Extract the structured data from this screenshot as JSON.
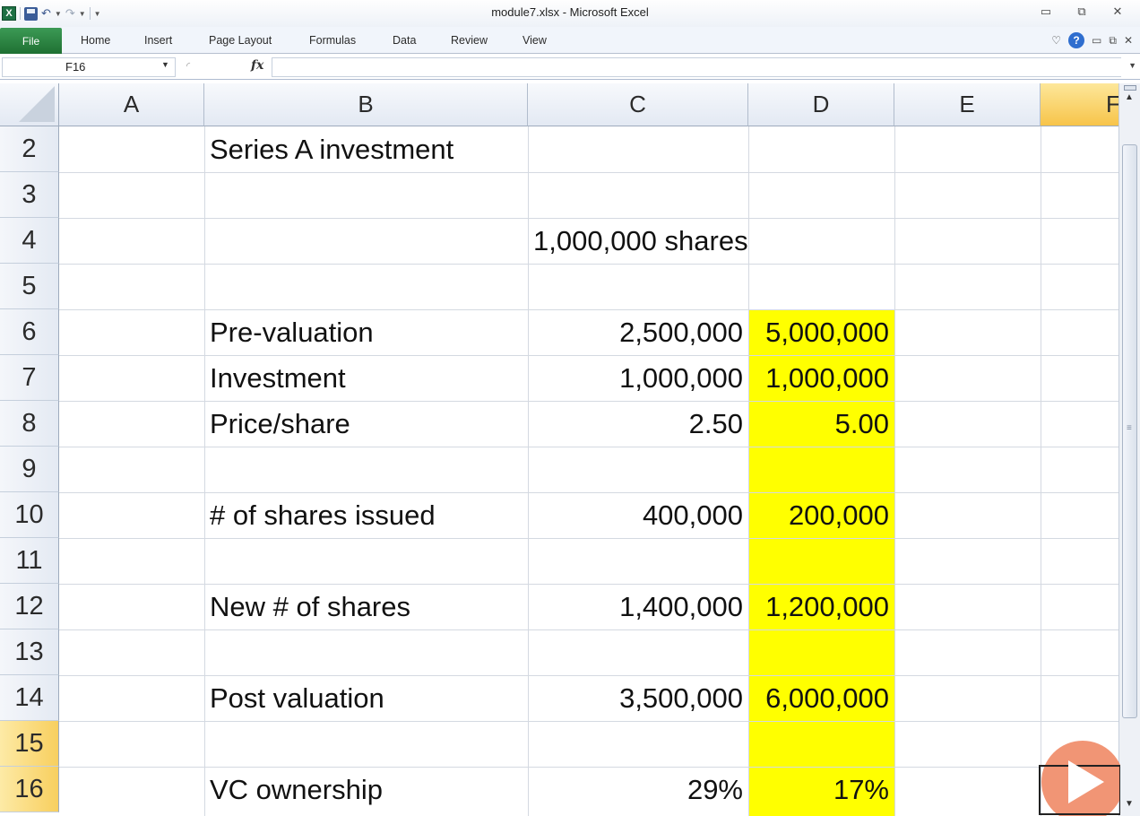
{
  "window": {
    "title": "module7.xlsx - Microsoft Excel",
    "app_icon": "excel-icon",
    "quick_access": [
      "save-icon",
      "undo-icon",
      "redo-icon",
      "customize-icon"
    ],
    "controls": [
      "minimize-icon",
      "restore-icon",
      "close-icon"
    ]
  },
  "ribbon": {
    "file_label": "File",
    "tabs": [
      "Home",
      "Insert",
      "Page Layout",
      "Formulas",
      "Data",
      "Review",
      "View"
    ],
    "right_icons": [
      "minimize-ribbon-icon",
      "help-icon",
      "minimize-icon",
      "restore-icon",
      "close-icon"
    ]
  },
  "formula_bar": {
    "name_box": "F16",
    "fx_label": "fx",
    "formula": ""
  },
  "sheet": {
    "selected_cell": "F16",
    "columns": [
      "A",
      "B",
      "C",
      "D",
      "E",
      "F"
    ],
    "rows": [
      "2",
      "3",
      "4",
      "5",
      "6",
      "7",
      "8",
      "9",
      "10",
      "11",
      "12",
      "13",
      "14",
      "15",
      "16"
    ],
    "cells": {
      "B2": "Series A investment",
      "C4": "1,000,000 shares",
      "B6": "Pre-valuation",
      "C6": "2,500,000",
      "D6": "5,000,000",
      "B7": "Investment",
      "C7": "1,000,000",
      "D7": "1,000,000",
      "B8": "Price/share",
      "C8": "2.50",
      "D8": "5.00",
      "B10": "# of shares issued",
      "C10": "400,000",
      "D10": "200,000",
      "B12": "New # of shares",
      "C12": "1,400,000",
      "D12": "1,200,000",
      "B14": "Post valuation",
      "C14": "3,500,000",
      "D14": "6,000,000",
      "B16": "VC ownership",
      "C16": "29%",
      "D16": "17%"
    },
    "highlight_color": "#ffff00"
  },
  "overlay": {
    "play_button_color": "#f08a66"
  }
}
